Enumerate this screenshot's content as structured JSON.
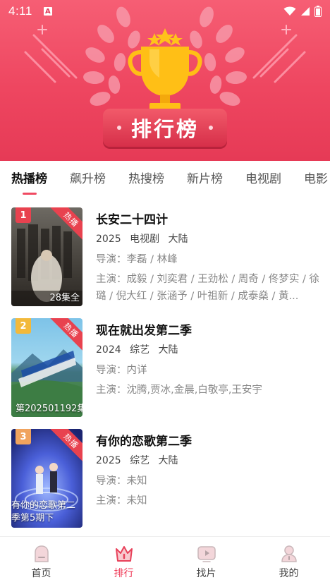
{
  "status_bar": {
    "time": "4:11",
    "notif_letter": "A"
  },
  "header": {
    "title": "排行榜"
  },
  "tabs": [
    {
      "label": "热播榜",
      "active": true
    },
    {
      "label": "飙升榜",
      "active": false
    },
    {
      "label": "热搜榜",
      "active": false
    },
    {
      "label": "新片榜",
      "active": false
    },
    {
      "label": "电视剧",
      "active": false
    },
    {
      "label": "电影",
      "active": false
    }
  ],
  "items": [
    {
      "rank": "1",
      "rank_color": "#e8424f",
      "badge": "热播",
      "episodes": "28集全",
      "title": "长安二十四计",
      "year": "2025",
      "genre": "电视剧",
      "region": "大陆",
      "director": "导演：李磊 / 林峰",
      "cast": "主演：成毅 / 刘奕君 / 王劲松 / 周奇 / 佟梦实 / 徐璐 / 倪大红 / 张涵予 / 叶祖新 / 成泰燊 / 黄..."
    },
    {
      "rank": "2",
      "rank_color": "#f2b93b",
      "badge": "热播",
      "episodes": "第202501192集",
      "title": "现在就出发第二季",
      "year": "2024",
      "genre": "综艺",
      "region": "大陆",
      "director": "导演：内详",
      "cast": "主演：沈腾,贾冰,金晨,白敬亭,王安宇"
    },
    {
      "rank": "3",
      "rank_color": "#f0a35e",
      "badge": "热播",
      "episodes": "有你的恋歌第二季第5期下",
      "title": "有你的恋歌第二季",
      "year": "2025",
      "genre": "综艺",
      "region": "大陆",
      "director": "导演：未知",
      "cast": "主演：未知"
    }
  ],
  "nav": [
    {
      "label": "首页",
      "icon": "home-icon",
      "active": false
    },
    {
      "label": "排行",
      "icon": "crown-icon",
      "active": true
    },
    {
      "label": "找片",
      "icon": "play-icon",
      "active": false
    },
    {
      "label": "我的",
      "icon": "user-icon",
      "active": false
    }
  ],
  "colors": {
    "accent": "#ef3b58",
    "hero_top": "#f65e74",
    "hero_bottom": "#e63a56"
  }
}
